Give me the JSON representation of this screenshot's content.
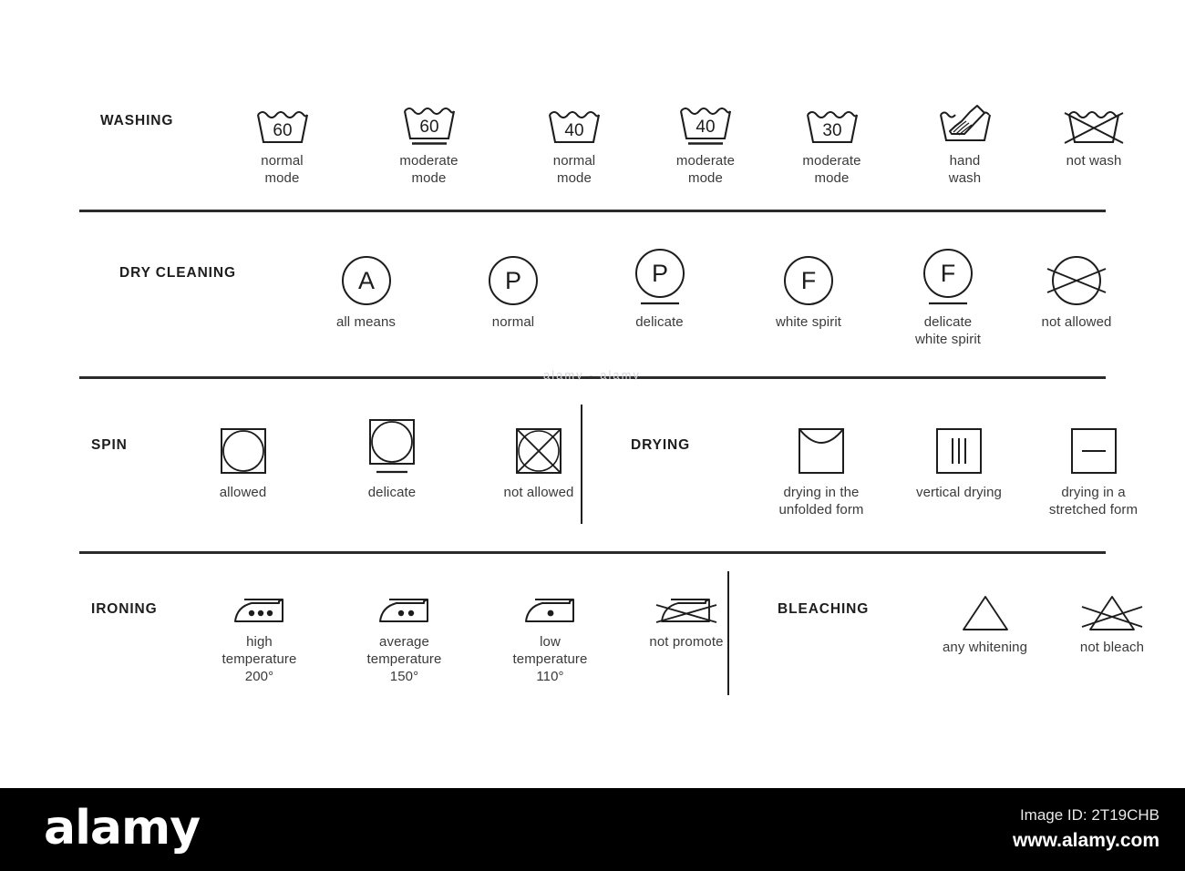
{
  "theme": {
    "background": "#ffffff",
    "ink": "#1d1d1d",
    "caption_color": "#3a3a3a",
    "divider_color": "#2b2b2b",
    "footer_background": "#000000",
    "footer_text": "#ffffff"
  },
  "sections": [
    {
      "id": "washing",
      "label": "WASHING",
      "items": [
        {
          "icon": "wash-tub-60-icon",
          "caption": "normal\nmode",
          "temperature": "60"
        },
        {
          "icon": "wash-tub-60-bar-icon",
          "caption": "moderate\nmode",
          "temperature": "60"
        },
        {
          "icon": "wash-tub-40-icon",
          "caption": "normal\nmode",
          "temperature": "40"
        },
        {
          "icon": "wash-tub-40-bar-icon",
          "caption": "moderate\nmode",
          "temperature": "40"
        },
        {
          "icon": "wash-tub-30-bar-icon",
          "caption": "moderate\nmode",
          "temperature": "30"
        },
        {
          "icon": "hand-wash-icon",
          "caption": "hand\nwash",
          "temperature": ""
        },
        {
          "icon": "do-not-wash-icon",
          "caption": "not wash",
          "temperature": ""
        }
      ]
    },
    {
      "id": "dry-cleaning",
      "label": "DRY CLEANING",
      "items": [
        {
          "icon": "dryclean-circle-a-icon",
          "caption": "all means",
          "letter": "A"
        },
        {
          "icon": "dryclean-circle-p-icon",
          "caption": "normal",
          "letter": "P"
        },
        {
          "icon": "dryclean-circle-p-bar-icon",
          "caption": "delicate",
          "letter": "P"
        },
        {
          "icon": "dryclean-circle-f-icon",
          "caption": "white spirit",
          "letter": "F"
        },
        {
          "icon": "dryclean-circle-f-bar-icon",
          "caption": "delicate\nwhite spirit",
          "letter": "F"
        },
        {
          "icon": "dryclean-not-allowed-icon",
          "caption": "not allowed",
          "letter": ""
        }
      ]
    },
    {
      "id": "spin",
      "label": "SPIN",
      "items": [
        {
          "icon": "spin-allowed-icon",
          "caption": "allowed"
        },
        {
          "icon": "spin-delicate-icon",
          "caption": "delicate"
        },
        {
          "icon": "spin-not-allowed-icon",
          "caption": "not allowed"
        }
      ]
    },
    {
      "id": "drying",
      "label": "DRYING",
      "items": [
        {
          "icon": "drying-flat-icon",
          "caption": "drying in the\nunfolded form"
        },
        {
          "icon": "drying-vertical-icon",
          "caption": "vertical drying"
        },
        {
          "icon": "drying-stretch-icon",
          "caption": "drying in a\nstretched form"
        }
      ]
    },
    {
      "id": "ironing",
      "label": "IRONING",
      "items": [
        {
          "icon": "iron-three-dots-icon",
          "caption": "high\ntemperature\n200°",
          "dots": 3
        },
        {
          "icon": "iron-two-dots-icon",
          "caption": "average\ntemperature\n150°",
          "dots": 2
        },
        {
          "icon": "iron-one-dot-icon",
          "caption": "low\ntemperature\n110°",
          "dots": 1
        },
        {
          "icon": "iron-not-allowed-icon",
          "caption": "not promote",
          "dots": 0
        }
      ]
    },
    {
      "id": "bleaching",
      "label": "BLEACHING",
      "items": [
        {
          "icon": "bleach-triangle-icon",
          "caption": "any whitening"
        },
        {
          "icon": "bleach-not-allowed-icon",
          "caption": "not bleach"
        }
      ]
    }
  ],
  "watermark": {
    "smudge_text": "alamy - alamy"
  },
  "footer": {
    "brand": "alamy",
    "image_id_label": "Image ID: 2T19CHB",
    "website": "www.alamy.com"
  }
}
